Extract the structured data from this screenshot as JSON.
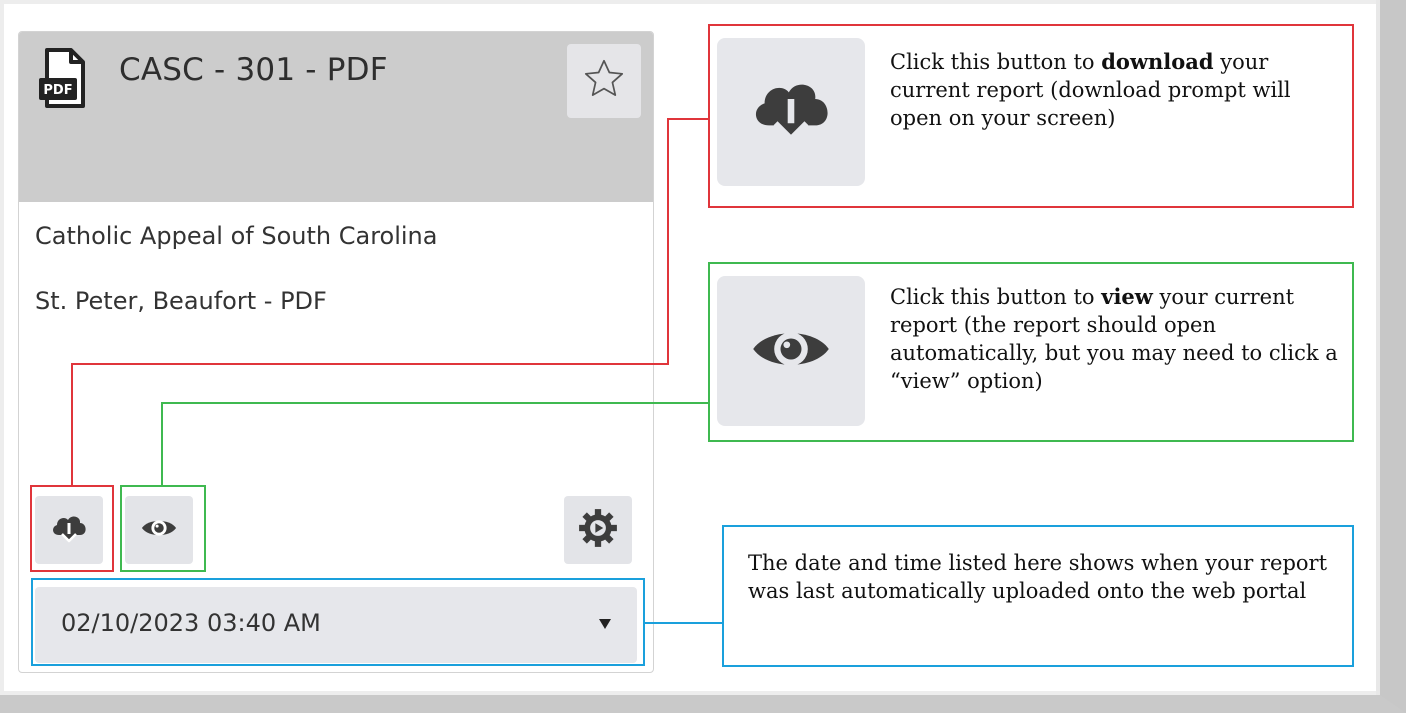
{
  "card": {
    "title": "CASC - 301 - PDF",
    "line1": "Catholic Appeal of South Carolina",
    "line2": "St. Peter, Beaufort - PDF",
    "date_value": "02/10/2023 03:40 AM",
    "icons": {
      "file": "pdf-file-icon",
      "favorite": "star-outline-icon",
      "download": "cloud-download-icon",
      "view": "eye-icon",
      "settings": "gear-play-icon",
      "dropdown": "caret-down-icon"
    }
  },
  "callouts": {
    "download": {
      "prefix": "Click this button to ",
      "bold": "download",
      "suffix": " your current report (download prompt will open on your screen)"
    },
    "view": {
      "prefix": "Click this button to ",
      "bold": "view",
      "suffix": " your current report (the report should open automatically, but you may need to click a “view” option)"
    },
    "date": {
      "text": "The date and time listed here shows when your report was last automatically uploaded onto the web portal"
    }
  },
  "colors": {
    "download_highlight": "#e0353b",
    "view_highlight": "#3fb950",
    "date_highlight": "#1aa0dc",
    "header_bg": "#cccccc",
    "button_bg": "#e3e4e8"
  }
}
